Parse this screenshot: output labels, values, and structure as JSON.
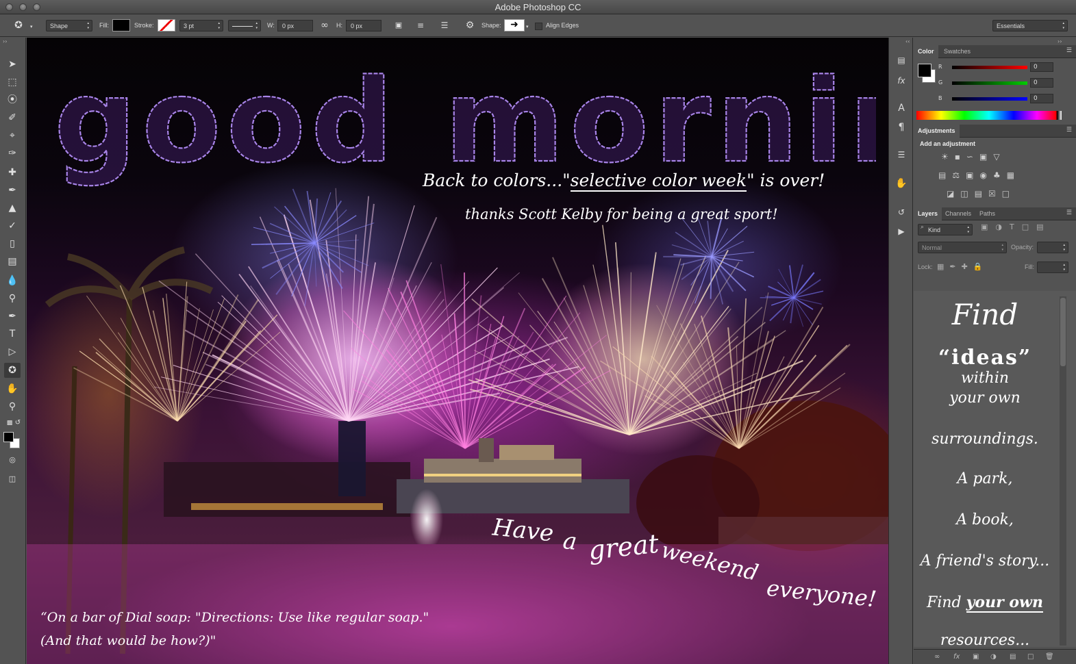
{
  "app": {
    "title": "Adobe Photoshop CC"
  },
  "options": {
    "mode": "Shape",
    "fill_label": "Fill:",
    "stroke_label": "Stroke:",
    "stroke_width": "3 pt",
    "w_label": "W:",
    "w_value": "0 px",
    "h_label": "H:",
    "h_value": "0 px",
    "shape_label": "Shape:",
    "align_edges": "Align Edges",
    "workspace": "Essentials"
  },
  "canvas": {
    "headline": "good morning!",
    "subhead1_pre": "Back to colors...\"",
    "subhead1_u": "selective color week",
    "subhead1_post": "\" is over!",
    "subhead2": "thanks Scott Kelby for being a great sport!",
    "weekend_words": [
      "Have",
      "a",
      "great",
      "weekend",
      "everyone!"
    ],
    "quote_line1": "“On a bar of Dial soap: \"Directions: Use like regular soap.\"",
    "quote_line2": "(And that would be how?)\""
  },
  "color_panel": {
    "tabs": [
      "Color",
      "Swatches"
    ],
    "channels": [
      {
        "label": "R",
        "value": "0"
      },
      {
        "label": "G",
        "value": "0"
      },
      {
        "label": "B",
        "value": "0"
      }
    ]
  },
  "adjustments_panel": {
    "title": "Adjustments",
    "add_label": "Add an adjustment"
  },
  "layers_panel": {
    "tabs": [
      "Layers",
      "Channels",
      "Paths"
    ],
    "filter": "Kind",
    "blend_mode": "Normal",
    "opacity_label": "Opacity:",
    "lock_label": "Lock:",
    "fill_label": "Fill:"
  },
  "sidebar_quote": {
    "l1": "Find",
    "l2a": "“ideas”",
    "l2b": "within",
    "l3": "your own",
    "l4": "surroundings.",
    "l5": "A park,",
    "l6": "A book,",
    "l7": "A friend's story...",
    "l8a": "Find",
    "l8b": "your own",
    "l9": "resources..."
  }
}
